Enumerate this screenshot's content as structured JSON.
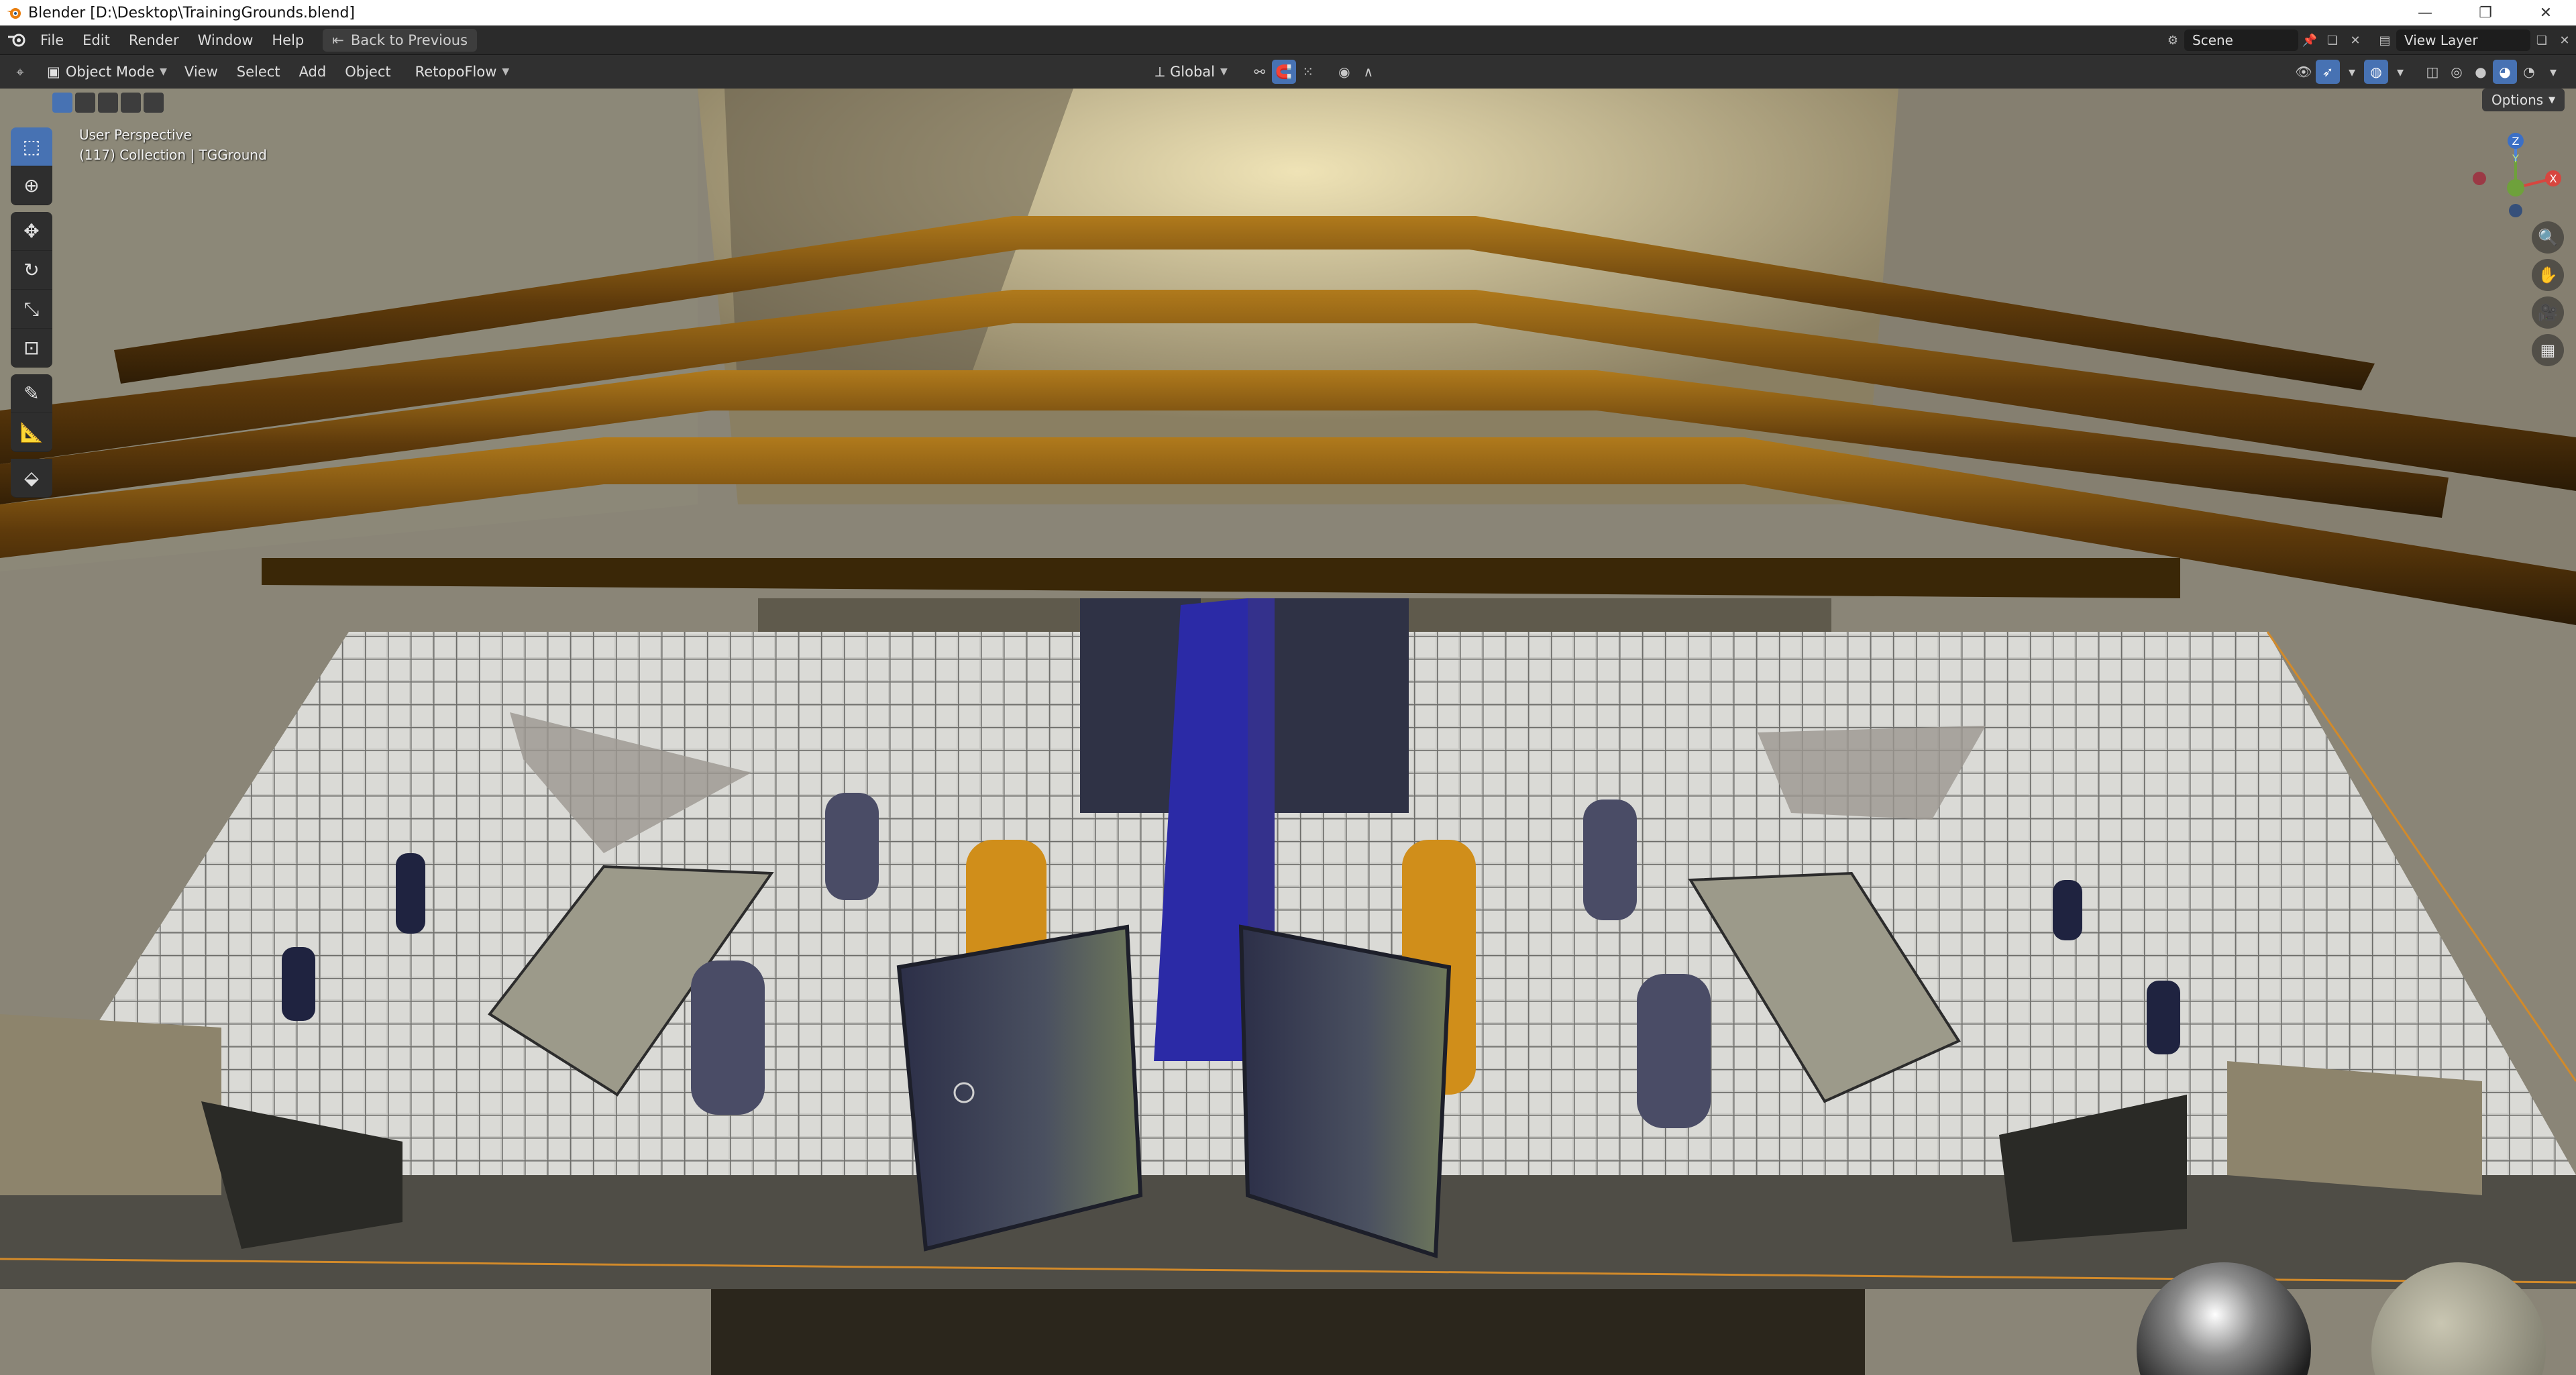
{
  "window": {
    "title": "Blender [D:\\Desktop\\TrainingGrounds.blend]",
    "controls": [
      "—",
      "❐",
      "✕"
    ]
  },
  "menu": {
    "items": [
      "File",
      "Edit",
      "Render",
      "Window",
      "Help"
    ],
    "back_button": "Back to Previous"
  },
  "topbar_right": {
    "scene": "Scene",
    "view_layer": "View Layer"
  },
  "viewheader": {
    "mode": "Object Mode",
    "menus": [
      "View",
      "Select",
      "Add",
      "Object"
    ],
    "addon_menu": "RetopoFlow",
    "orientation": "Global"
  },
  "viewport": {
    "perspective_label": "User Perspective",
    "collection_label": "(117) Collection | TGGround",
    "options_label": "Options",
    "gizmo_axes": [
      "Z",
      "Y",
      "X"
    ]
  },
  "toolbar": {
    "tools": [
      "select-box",
      "cursor",
      "move",
      "rotate",
      "scale",
      "transform",
      "annotate",
      "measure",
      "add-cube"
    ]
  },
  "colors": {
    "accent": "#4772b3",
    "header_bg": "#303030",
    "topbar_bg": "#2b2b2b"
  }
}
